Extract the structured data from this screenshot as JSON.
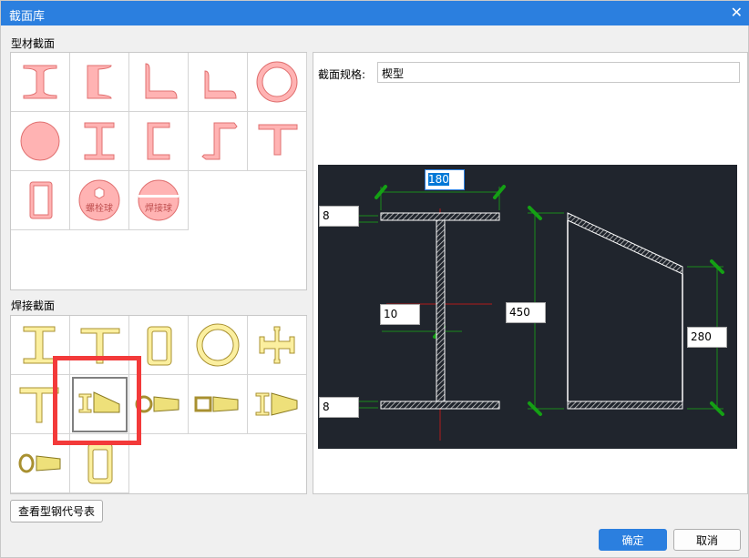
{
  "window": {
    "title": "截面库",
    "close_icon": "close-icon"
  },
  "profile_section": {
    "label": "型材截面",
    "items": [
      "工字钢",
      "槽钢",
      "等边角钢",
      "不等边角钢",
      "圆管",
      "圆钢",
      "H型钢",
      "冷弯槽钢",
      "Z型钢",
      "T型钢",
      "矩形管",
      "螺栓球",
      "焊接球"
    ],
    "bolt_ball_text": "螺栓球",
    "weld_ball_text": "焊接球"
  },
  "weld_section": {
    "label": "焊接截面",
    "items": [
      "焊接工字形",
      "焊接T形",
      "焊接箱形",
      "焊接圆管",
      "十字形",
      "T形",
      "变截面工字形",
      "圆管变截面",
      "箱形变截面",
      "工字变截面",
      "椭圆变截面",
      "矩形"
    ],
    "selected_index": 6
  },
  "spec": {
    "label": "截面规格:",
    "value": "楔型"
  },
  "dims": {
    "top_width": "180",
    "top_flange": "8",
    "web": "10",
    "height_left": "450",
    "height_right": "280",
    "bottom_flange": "8"
  },
  "buttons": {
    "table": "查看型钢代号表",
    "ok": "确定",
    "cancel": "取消"
  },
  "colors": {
    "accent": "#2b7fdf",
    "highlight": "#f33a3a",
    "profile_fill": "#ffb3b3",
    "weld_fill": "#fbef9f"
  }
}
